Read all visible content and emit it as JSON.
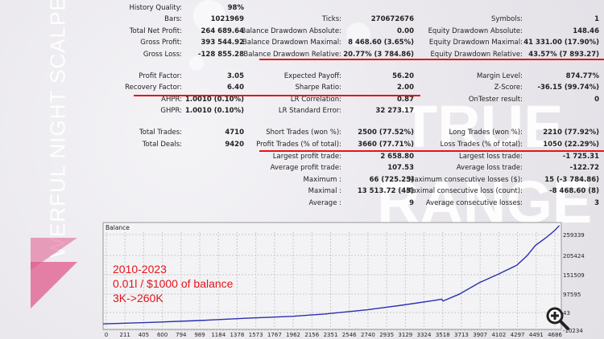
{
  "branding": {
    "vertical_title": "WERFUL NIGHT SCALPER",
    "watermark": [
      "TRUE",
      "RANGE"
    ],
    "accent": "#e4141b",
    "triangle_color": "#e05a8c"
  },
  "report": {
    "col1": [
      {
        "label": "History Quality:",
        "value": "98%",
        "row": 0
      },
      {
        "label": "Bars:",
        "value": "1021969",
        "row": 1
      },
      {
        "label": "Total Net Profit:",
        "value": "264 689.64",
        "row": 2
      },
      {
        "label": "Gross Profit:",
        "value": "393 544.92",
        "row": 3
      },
      {
        "label": "Gross Loss:",
        "value": "-128 855.28",
        "row": 4
      },
      {
        "label": "Profit Factor:",
        "value": "3.05",
        "row": 6
      },
      {
        "label": "Recovery Factor:",
        "value": "6.40",
        "row": 7
      },
      {
        "label": "AHPR:",
        "value": "1.0010 (0.10%)",
        "row": 8
      },
      {
        "label": "GHPR:",
        "value": "1.0010 (0.10%)",
        "row": 9
      },
      {
        "label": "Total Trades:",
        "value": "4710",
        "row": 11
      },
      {
        "label": "Total Deals:",
        "value": "9420",
        "row": 12
      }
    ],
    "col2": [
      {
        "label": "Ticks:",
        "value": "270672676",
        "row": 1
      },
      {
        "label": "Balance Drawdown Absolute:",
        "value": "0.00",
        "row": 2
      },
      {
        "label": "Balance Drawdown Maximal:",
        "value": "8 468.60 (3.65%)",
        "row": 3
      },
      {
        "label": "Balance Drawdown Relative:",
        "value": "20.77% (3 784.86)",
        "row": 4
      },
      {
        "label": "Expected Payoff:",
        "value": "56.20",
        "row": 6
      },
      {
        "label": "Sharpe Ratio:",
        "value": "2.00",
        "row": 7
      },
      {
        "label": "LR Correlation:",
        "value": "0.87",
        "row": 8
      },
      {
        "label": "LR Standard Error:",
        "value": "32 273.17",
        "row": 9
      },
      {
        "label": "Short Trades (won %):",
        "value": "2500 (77.52%)",
        "row": 11
      },
      {
        "label": "Profit Trades (% of total):",
        "value": "3660 (77.71%)",
        "row": 12
      },
      {
        "label": "Largest profit trade:",
        "value": "2 658.80",
        "row": 13
      },
      {
        "label": "Average profit trade:",
        "value": "107.53",
        "row": 14
      },
      {
        "label": "Maximum :",
        "value": "66 (725.25)",
        "row": 15
      },
      {
        "label": "Maximal :",
        "value": "13 513.72 (43)",
        "row": 16
      },
      {
        "label": "Average :",
        "value": "9",
        "row": 17
      }
    ],
    "col3": [
      {
        "label": "Symbols:",
        "value": "1",
        "row": 1
      },
      {
        "label": "Equity Drawdown Absolute:",
        "value": "148.46",
        "row": 2
      },
      {
        "label": "Equity Drawdown Maximal:",
        "value": "41 331.00 (17.90%)",
        "row": 3
      },
      {
        "label": "Equity Drawdown Relative:",
        "value": "43.57% (7 893.27)",
        "row": 4
      },
      {
        "label": "Margin Level:",
        "value": "874.77%",
        "row": 6
      },
      {
        "label": "Z-Score:",
        "value": "-36.15 (99.74%)",
        "row": 7
      },
      {
        "label": "OnTester result:",
        "value": "0",
        "row": 8
      },
      {
        "label": "Long Trades (won %):",
        "value": "2210 (77.92%)",
        "row": 11
      },
      {
        "label": "Loss Trades (% of total):",
        "value": "1050 (22.29%)",
        "row": 12
      },
      {
        "label": "Largest loss trade:",
        "value": "-1 725.31",
        "row": 13
      },
      {
        "label": "Average loss trade:",
        "value": "-122.72",
        "row": 14
      },
      {
        "label": "Maximum consecutive losses ($):",
        "value": "15 (-3 784.86)",
        "row": 15
      },
      {
        "label": "Maximal consecutive loss (count):",
        "value": "-8 468.60 (8)",
        "row": 16
      },
      {
        "label": "Average consecutive losses:",
        "value": "3",
        "row": 17
      }
    ]
  },
  "annotation": [
    "2010-2023",
    "0.01l / $1000 of balance",
    "3K->260K"
  ],
  "chart_data": {
    "type": "line",
    "title": "Balance",
    "x_ticks": [
      "0",
      "211",
      "405",
      "600",
      "794",
      "989",
      "1184",
      "1378",
      "1573",
      "1767",
      "1962",
      "2156",
      "2351",
      "2546",
      "2740",
      "2935",
      "3129",
      "3324",
      "3518",
      "3713",
      "3907",
      "4102",
      "4297",
      "4491",
      "4686"
    ],
    "y_ticks": [
      "259339",
      "205424",
      "151509",
      "97595",
      "43",
      "-10234"
    ],
    "xlim": [
      0,
      4760
    ],
    "ylim": [
      -10234,
      270000
    ],
    "grid": true,
    "line_color": "#2a2fb0",
    "series": [
      {
        "x": [
          0,
          500,
          1000,
          1500,
          1962,
          2300,
          2740,
          3100,
          3450,
          3518,
          3530,
          3700,
          3907,
          4102,
          4297,
          4400,
          4491,
          4600,
          4686,
          4740
        ],
        "y": [
          4000,
          8000,
          13000,
          19000,
          24000,
          30000,
          41000,
          53000,
          66000,
          69000,
          64000,
          82000,
          112000,
          134000,
          158000,
          182000,
          210000,
          230000,
          248000,
          262000
        ]
      }
    ]
  }
}
